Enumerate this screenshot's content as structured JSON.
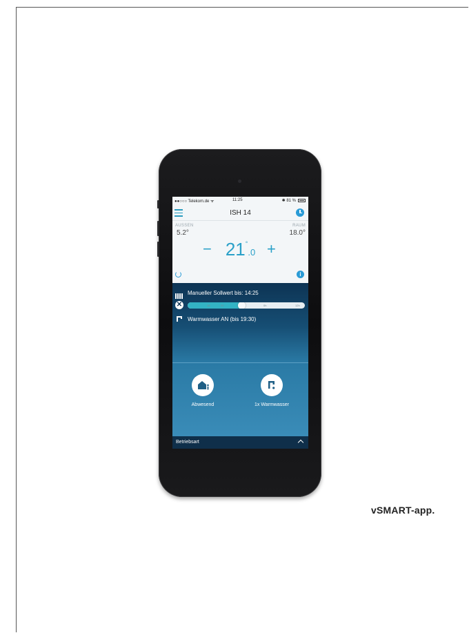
{
  "caption": "vSMART-app.",
  "status_bar": {
    "carrier": "●●○○○ Telekom.de ᯤ",
    "time": "11:25",
    "battery": "✱ 81 %"
  },
  "header": {
    "title": "ISH 14",
    "menu_icon": "menu-icon",
    "schedule_icon": "clock-icon"
  },
  "temperature": {
    "outside_label": "AUSSEN",
    "outside_value": "5.2°",
    "room_label": "RAUM",
    "room_value": "18.0°",
    "setpoint_int": "21",
    "setpoint_deg": "°",
    "setpoint_dec": ".0",
    "minus": "−",
    "plus": "+"
  },
  "status": {
    "manual_text": "Manueller Sollwert bis: 14:25",
    "dhw_text": "Warmwasser AN (bis 19:30)",
    "timeline_ticks": [
      "18",
      "20",
      "0h",
      "12h"
    ],
    "timeline_progress": 0.46,
    "accent_color": "#33b3c4"
  },
  "actions": [
    {
      "label": "Abwesend",
      "icon": "away-house-icon"
    },
    {
      "label": "1x Warmwasser",
      "icon": "faucet-icon"
    }
  ],
  "bottom_bar": {
    "label": "Betriebsart",
    "icon": "chevron-up-icon"
  }
}
